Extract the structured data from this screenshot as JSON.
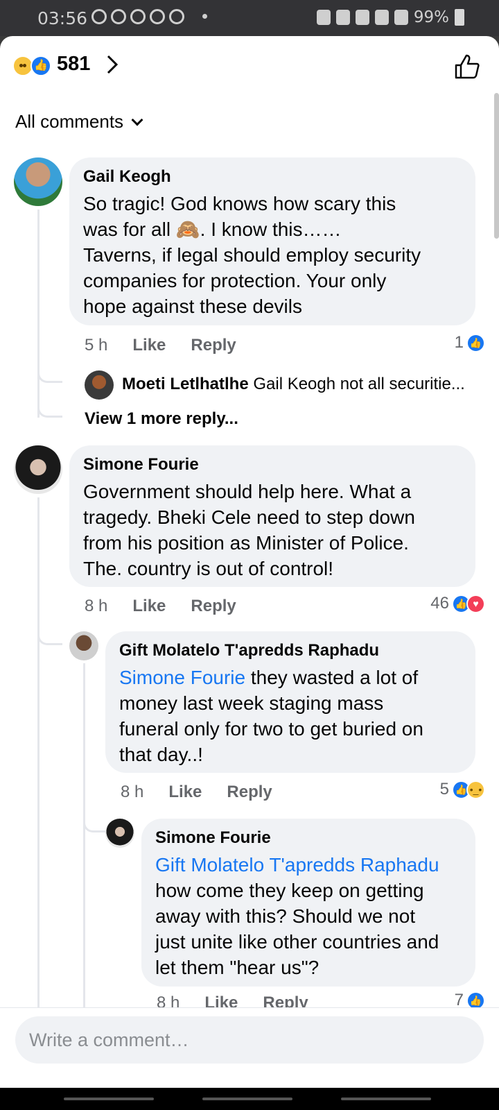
{
  "status_bar": {
    "time": "03:56",
    "battery": "99%"
  },
  "header": {
    "reaction_count": "581"
  },
  "filter": {
    "label": "All comments"
  },
  "comments": [
    {
      "author": "Gail Keogh",
      "text_lines": [
        "So tragic!  God knows how scary this",
        "was for all 🙈.   I know this……",
        "Taverns, if legal should employ security",
        "companies for protection. Your only",
        "hope against these devils"
      ],
      "time": "5 h",
      "like": "Like",
      "reply": "Reply",
      "reactions": "1",
      "reply_preview": {
        "author": "Moeti Letlhatlhe",
        "text": "Gail Keogh not all securitie..."
      },
      "view_more": "View 1 more reply..."
    },
    {
      "author": "Simone Fourie",
      "text_lines": [
        "Government should help here. What a",
        "tragedy. Bheki Cele need to step down",
        "from his position as Minister of Police.",
        "The. country is out of control!"
      ],
      "time": "8 h",
      "like": "Like",
      "reply": "Reply",
      "reactions": "46"
    },
    {
      "author": "Gift Molatelo T'apredds Raphadu",
      "mention": "Simone Fourie",
      "text_lines": [
        " they wasted a lot of",
        "money last week staging mass",
        "funeral only for two to get buried on",
        "that day..!"
      ],
      "time": "8 h",
      "like": "Like",
      "reply": "Reply",
      "reactions": "5"
    },
    {
      "author": "Simone Fourie",
      "mention": "Gift Molatelo T'apredds Raphadu",
      "text_lines": [
        "how come they keep on getting",
        "away with this? Should we not",
        "just unite like other countries and",
        "let them \"hear us\"?"
      ],
      "time": "8 h",
      "like": "Like",
      "reply": "Reply",
      "reactions": "7"
    }
  ],
  "composer": {
    "placeholder": "Write a comment…"
  },
  "colors": {
    "accent": "#1877f2",
    "bubble": "#f0f2f5"
  },
  "icons": [
    "sad-reaction-icon",
    "like-reaction-icon",
    "love-reaction-icon",
    "thumbs-up-icon",
    "chevron-right-icon",
    "chevron-down-icon"
  ]
}
